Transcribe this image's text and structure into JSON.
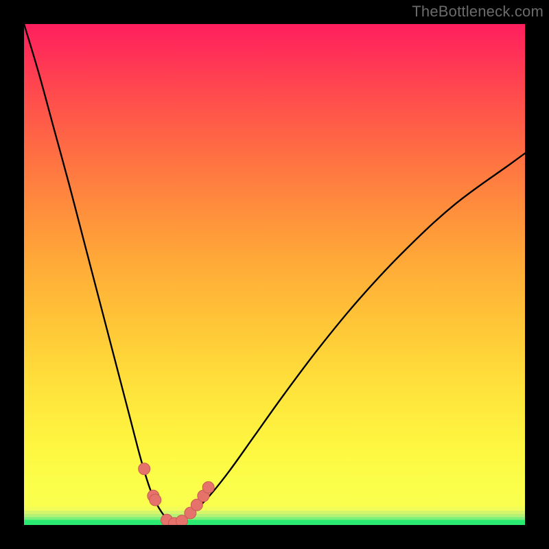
{
  "watermark": "TheBottleneck.com",
  "colors": {
    "frame": "#000000",
    "curve": "#000000",
    "marker_fill": "#e6736b",
    "marker_stroke": "#c85a52",
    "gradient_stops": [
      "#2bea72",
      "#7df07a",
      "#b4f276",
      "#d7f56a",
      "#f3fd59",
      "#faff4f",
      "#fbff4a",
      "#fef640",
      "#ffe13b",
      "#ffc637",
      "#ffab38",
      "#ff8e3c",
      "#ff6f43",
      "#ff4e4c",
      "#ff2e58",
      "#ff1f5e"
    ]
  },
  "chart_data": {
    "type": "line",
    "title": "",
    "xlabel": "",
    "ylabel": "",
    "xlim": [
      0,
      1
    ],
    "ylim": [
      0,
      1
    ],
    "note": "V-shaped bottleneck curve; y is mismatch fraction (0 = balanced). Minimum near x≈0.30.",
    "series": [
      {
        "name": "left-branch",
        "x": [
          0.0,
          0.03,
          0.06,
          0.09,
          0.12,
          0.15,
          0.18,
          0.21,
          0.235,
          0.255,
          0.275,
          0.295
        ],
        "y": [
          1.0,
          0.9,
          0.79,
          0.68,
          0.565,
          0.45,
          0.335,
          0.22,
          0.125,
          0.063,
          0.025,
          0.004
        ]
      },
      {
        "name": "right-branch",
        "x": [
          0.295,
          0.315,
          0.34,
          0.37,
          0.41,
          0.46,
          0.52,
          0.59,
          0.67,
          0.76,
          0.86,
          0.97,
          1.0
        ],
        "y": [
          0.004,
          0.01,
          0.028,
          0.058,
          0.108,
          0.178,
          0.262,
          0.355,
          0.452,
          0.548,
          0.64,
          0.72,
          0.742
        ]
      }
    ],
    "markers": {
      "name": "highlighted-points",
      "x": [
        0.24,
        0.258,
        0.262,
        0.285,
        0.3,
        0.315,
        0.332,
        0.345,
        0.358,
        0.368
      ],
      "y": [
        0.112,
        0.058,
        0.05,
        0.01,
        0.003,
        0.008,
        0.024,
        0.04,
        0.058,
        0.075
      ]
    }
  }
}
